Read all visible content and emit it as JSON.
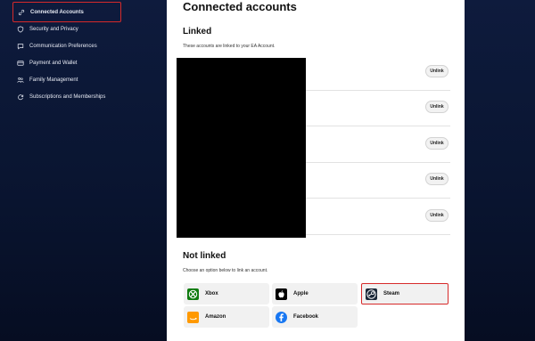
{
  "sidebar": {
    "items": [
      {
        "label": "Connected Accounts",
        "icon": "link-icon",
        "active": true
      },
      {
        "label": "Security and Privacy",
        "icon": "shield-lock-icon",
        "active": false
      },
      {
        "label": "Communication Preferences",
        "icon": "chat-bubble-icon",
        "active": false
      },
      {
        "label": "Payment and Wallet",
        "icon": "card-icon",
        "active": false
      },
      {
        "label": "Family Management",
        "icon": "family-icon",
        "active": false
      },
      {
        "label": "Subscriptions and Memberships",
        "icon": "refresh-icon",
        "active": false
      }
    ]
  },
  "main": {
    "title": "Connected accounts",
    "linked": {
      "title": "Linked",
      "description": "These accounts are linked to your EA Account.",
      "rows": [
        {
          "unlink_label": "Unlink"
        },
        {
          "unlink_label": "Unlink"
        },
        {
          "unlink_label": "Unlink"
        },
        {
          "unlink_label": "Unlink"
        },
        {
          "unlink_label": "Unlink"
        }
      ]
    },
    "not_linked": {
      "title": "Not linked",
      "description": "Choose an option below to link an account.",
      "options": [
        {
          "label": "Xbox",
          "icon": "xbox-icon",
          "color": "#107c10"
        },
        {
          "label": "Apple",
          "icon": "apple-icon",
          "color": "#000000"
        },
        {
          "label": "Steam",
          "icon": "steam-icon",
          "color": "#1b2838"
        },
        {
          "label": "Amazon",
          "icon": "amazon-icon",
          "color": "#ff9900"
        },
        {
          "label": "Facebook",
          "icon": "facebook-icon",
          "color": "#1877f2"
        }
      ]
    }
  },
  "colors": {
    "background": "#0b1736",
    "highlight": "#d62a2a",
    "panel": "#ffffff"
  }
}
